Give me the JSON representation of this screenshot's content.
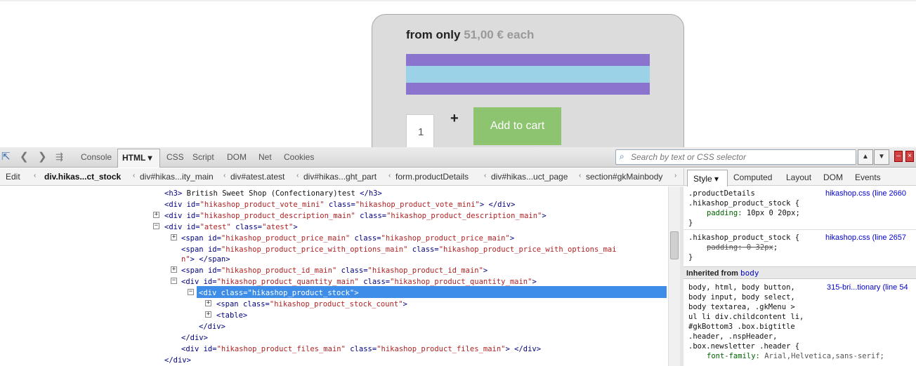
{
  "product_card": {
    "price_prefix": "from only",
    "price_amount": "51,00 €",
    "price_suffix": "each",
    "quantity_value": "1",
    "plus_symbol": "+",
    "add_to_cart_label": "Add to cart",
    "stripe_colors": {
      "outer": "#8a74cd",
      "inner": "#9bd2e8"
    }
  },
  "toolbar": {
    "tabs": [
      "Console",
      "HTML ▾",
      "CSS",
      "Script",
      "DOM",
      "Net",
      "Cookies"
    ],
    "search_placeholder": "Search by text or CSS selector",
    "icons": [
      "inspect-icon",
      "back-icon",
      "forward-icon",
      "command-line-icon",
      "search-icon"
    ]
  },
  "breadcrumbs": {
    "edit_label": "Edit",
    "items": [
      "div.hikas...ct_stock",
      "div#hikas...ity_main",
      "div#atest.atest",
      "div#hikas...ght_part",
      "form.productDetails",
      "div#hikas...uct_page",
      "section#gkMainbody"
    ]
  },
  "side_tabs": [
    "Style ▾",
    "Computed",
    "Layout",
    "DOM",
    "Events"
  ],
  "html_tree": {
    "lines": [
      {
        "parts": [
          [
            "tag",
            "<h3>"
          ],
          [
            "tx",
            " British Sweet Shop (Confectionary)test "
          ],
          [
            "tag",
            "</h3>"
          ]
        ]
      },
      {
        "parts": [
          [
            "tag",
            "<div "
          ],
          [
            "an",
            "id="
          ],
          [
            "av",
            "\"hikashop_product_vote_mini\""
          ],
          [
            "an",
            " class="
          ],
          [
            "av",
            "\"hikashop_product_vote_mini\""
          ],
          [
            "tag",
            ">  </div>"
          ]
        ]
      },
      {
        "parts": [
          [
            "tag",
            "<div "
          ],
          [
            "an",
            "id="
          ],
          [
            "av",
            "\"hikashop_product_description_main\""
          ],
          [
            "an",
            " class="
          ],
          [
            "av",
            "\"hikashop_product_description_main\""
          ],
          [
            "tag",
            ">"
          ]
        ]
      },
      {
        "parts": [
          [
            "tag",
            "<div "
          ],
          [
            "an",
            "id="
          ],
          [
            "av",
            "\"atest\""
          ],
          [
            "an",
            " class="
          ],
          [
            "av",
            "\"atest\""
          ],
          [
            "tag",
            ">"
          ]
        ]
      },
      {
        "parts": [
          [
            "tag",
            "<span "
          ],
          [
            "an",
            "id="
          ],
          [
            "av",
            "\"hikashop_product_price_main\""
          ],
          [
            "an",
            " class="
          ],
          [
            "av",
            "\"hikashop_product_price_main\""
          ],
          [
            "tag",
            ">"
          ]
        ]
      },
      {
        "parts": [
          [
            "tag",
            "<span "
          ],
          [
            "an",
            "id="
          ],
          [
            "av",
            "\"hikashop_product_price_with_options_main\""
          ],
          [
            "an",
            " class="
          ],
          [
            "av",
            "\"hikashop_product_price_with_options_mai"
          ]
        ]
      },
      {
        "parts": [
          [
            "av",
            "n\""
          ],
          [
            "tag",
            ">  </span>"
          ]
        ]
      },
      {
        "parts": [
          [
            "tag",
            "<span "
          ],
          [
            "an",
            "id="
          ],
          [
            "av",
            "\"hikashop_product_id_main\""
          ],
          [
            "an",
            " class="
          ],
          [
            "av",
            "\"hikashop_product_id_main\""
          ],
          [
            "tag",
            ">"
          ]
        ]
      },
      {
        "parts": [
          [
            "tag",
            "<div "
          ],
          [
            "an",
            "id="
          ],
          [
            "av",
            "\"hikashop_product_quantity_main\""
          ],
          [
            "an",
            " class="
          ],
          [
            "av",
            "\"hikashop_product_quantity_main\""
          ],
          [
            "tag",
            ">"
          ]
        ]
      },
      {
        "parts": [
          [
            "tag",
            "<div class=\"hikashop_product_stock\">"
          ]
        ]
      },
      {
        "parts": [
          [
            "tag",
            "<span "
          ],
          [
            "an",
            "class="
          ],
          [
            "av",
            "\"hikashop_product_stock_count\""
          ],
          [
            "tag",
            ">"
          ]
        ]
      },
      {
        "parts": [
          [
            "tag",
            "<table>"
          ]
        ]
      },
      {
        "parts": [
          [
            "tag",
            "</div>"
          ]
        ]
      },
      {
        "parts": [
          [
            "tag",
            "</div>"
          ]
        ]
      },
      {
        "parts": [
          [
            "tag",
            "<div "
          ],
          [
            "an",
            "id="
          ],
          [
            "av",
            "\"hikashop_product_files_main\""
          ],
          [
            "an",
            " class="
          ],
          [
            "av",
            "\"hikashop_product_files_main\""
          ],
          [
            "tag",
            ">  </div>"
          ]
        ]
      },
      {
        "parts": [
          [
            "tag",
            "</div>"
          ]
        ]
      }
    ]
  },
  "style_panel": {
    "rule1_selector_a": ".productDetails",
    "rule1_selector_b": ".hikashop_product_stock {",
    "rule1_source": "hikashop.css (line 2660",
    "rule1_prop": "padding",
    "rule1_value": " 10px 0 20px;",
    "rule2_selector": ".hikashop_product_stock {",
    "rule2_source": "hikashop.css (line 2657",
    "rule2_prop": "padding",
    "rule2_value": " 0 32px",
    "close_brace": "}",
    "inherited_label": "Inherited from",
    "inherited_from": "body",
    "rule3_selector_lines": [
      "body, html, body button,",
      "body input, body select,",
      "body textarea, .gkMenu >",
      "ul li div.childcontent li,",
      "#gkBottom3 .box.bigtitle",
      ".header, .nspHeader,",
      ".box.newsletter .header {"
    ],
    "rule3_source": "315-bri...tionary (line 54",
    "rule3_prop": "font-family",
    "rule3_value": " Arial,Helvetica,sans-serif;"
  }
}
